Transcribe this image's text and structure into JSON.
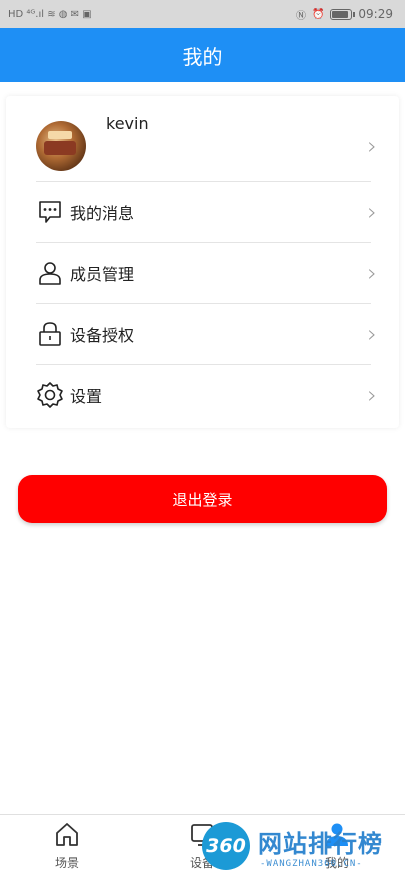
{
  "status_bar": {
    "left_glyphs": "HD ⁴ᴳ.ıl ≋ ◍ ✉ ▣",
    "time": "09:29"
  },
  "header": {
    "title": "我的"
  },
  "profile": {
    "username": "kevin"
  },
  "menu": [
    {
      "label": "我的消息",
      "icon": "message-icon"
    },
    {
      "label": "成员管理",
      "icon": "person-icon"
    },
    {
      "label": "设备授权",
      "icon": "lock-icon"
    },
    {
      "label": "设置",
      "icon": "gear-icon"
    }
  ],
  "logout": {
    "label": "退出登录",
    "color": "#ff0000"
  },
  "bottom_nav": [
    {
      "label": "场景",
      "icon": "home-icon"
    },
    {
      "label": "设备",
      "icon": "device-icon"
    },
    {
      "label": "我的",
      "icon": "user-icon"
    }
  ],
  "watermark": {
    "badge": "360",
    "text": "网站排行榜",
    "sub": "-WANGZHAN360.CN-"
  },
  "colors": {
    "accent": "#1e8ff5",
    "logout": "#ff0000"
  }
}
